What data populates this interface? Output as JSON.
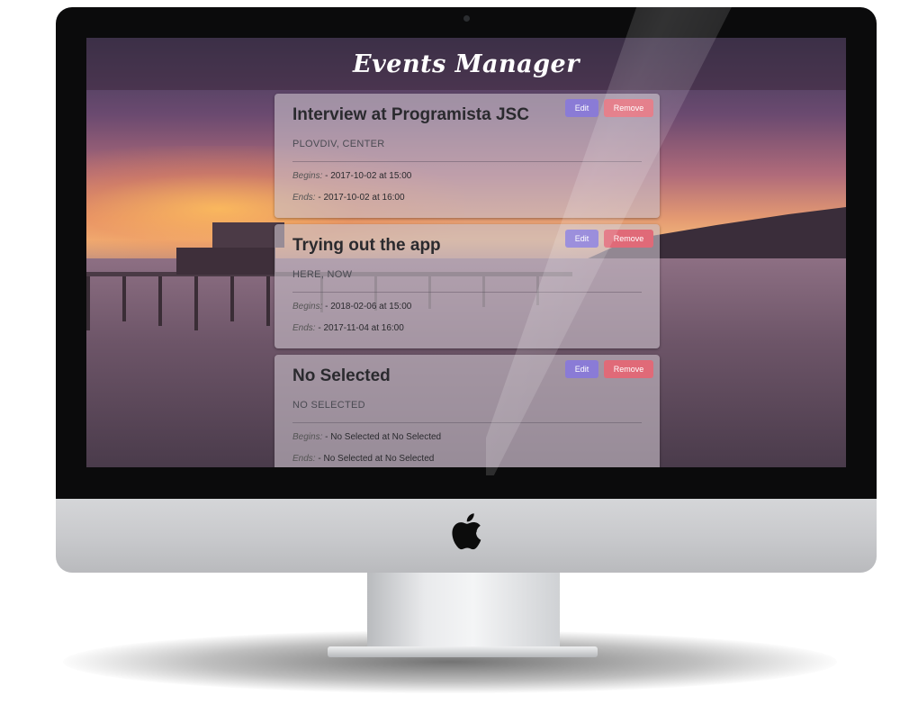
{
  "app": {
    "title": "Events Manager"
  },
  "actions": {
    "edit_label": "Edit",
    "remove_label": "Remove"
  },
  "labels": {
    "begins": "Begins:",
    "ends": "Ends:"
  },
  "events": [
    {
      "title": "Interview at Programista JSC",
      "location": "PLOVDIV, CENTER",
      "begins": "- 2017-10-02 at 15:00",
      "ends": "- 2017-10-02 at 16:00"
    },
    {
      "title": "Trying out the app",
      "location": "HERE, NOW",
      "begins": "- 2018-02-06 at 15:00",
      "ends": "- 2017-11-04 at 16:00"
    },
    {
      "title": "No Selected",
      "location": "NO SELECTED",
      "begins": "- No Selected at No Selected",
      "ends": "- No Selected at No Selected"
    }
  ],
  "colors": {
    "edit_button": "#8a7bd6",
    "remove_button": "#e06a78"
  },
  "icons": {
    "device_logo": "apple-logo-icon"
  }
}
